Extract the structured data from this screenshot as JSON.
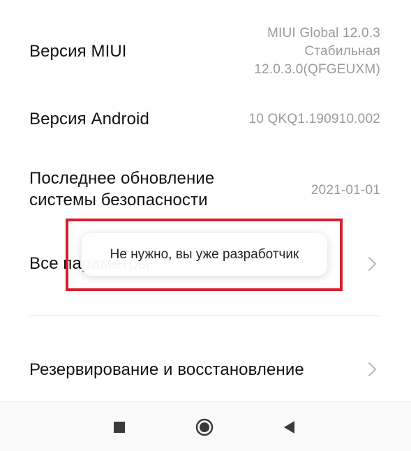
{
  "rows": {
    "miui": {
      "label": "Версия MIUI",
      "value_lines": [
        "MIUI Global 12.0.3",
        "Стабильная",
        "12.0.3.0(QFGEUXM)"
      ]
    },
    "android": {
      "label": "Версия Android",
      "value": "10 QKQ1.190910.002"
    },
    "security": {
      "label_lines": [
        "Последнее обновление",
        "системы безопасности"
      ],
      "value": "2021-01-01"
    },
    "all_params": {
      "label": "Все параметры"
    },
    "backup": {
      "label": "Резервирование и восстановление"
    }
  },
  "toast": {
    "text": "Не нужно, вы уже разработчик"
  },
  "nav": {
    "recent_icon": "square-icon",
    "home_icon": "circle-icon",
    "back_icon": "triangle-back-icon"
  },
  "colors": {
    "label": "#111111",
    "value": "#9a9a9a",
    "highlight": "#d81f2c",
    "nav_icon": "#3a3a3a"
  }
}
